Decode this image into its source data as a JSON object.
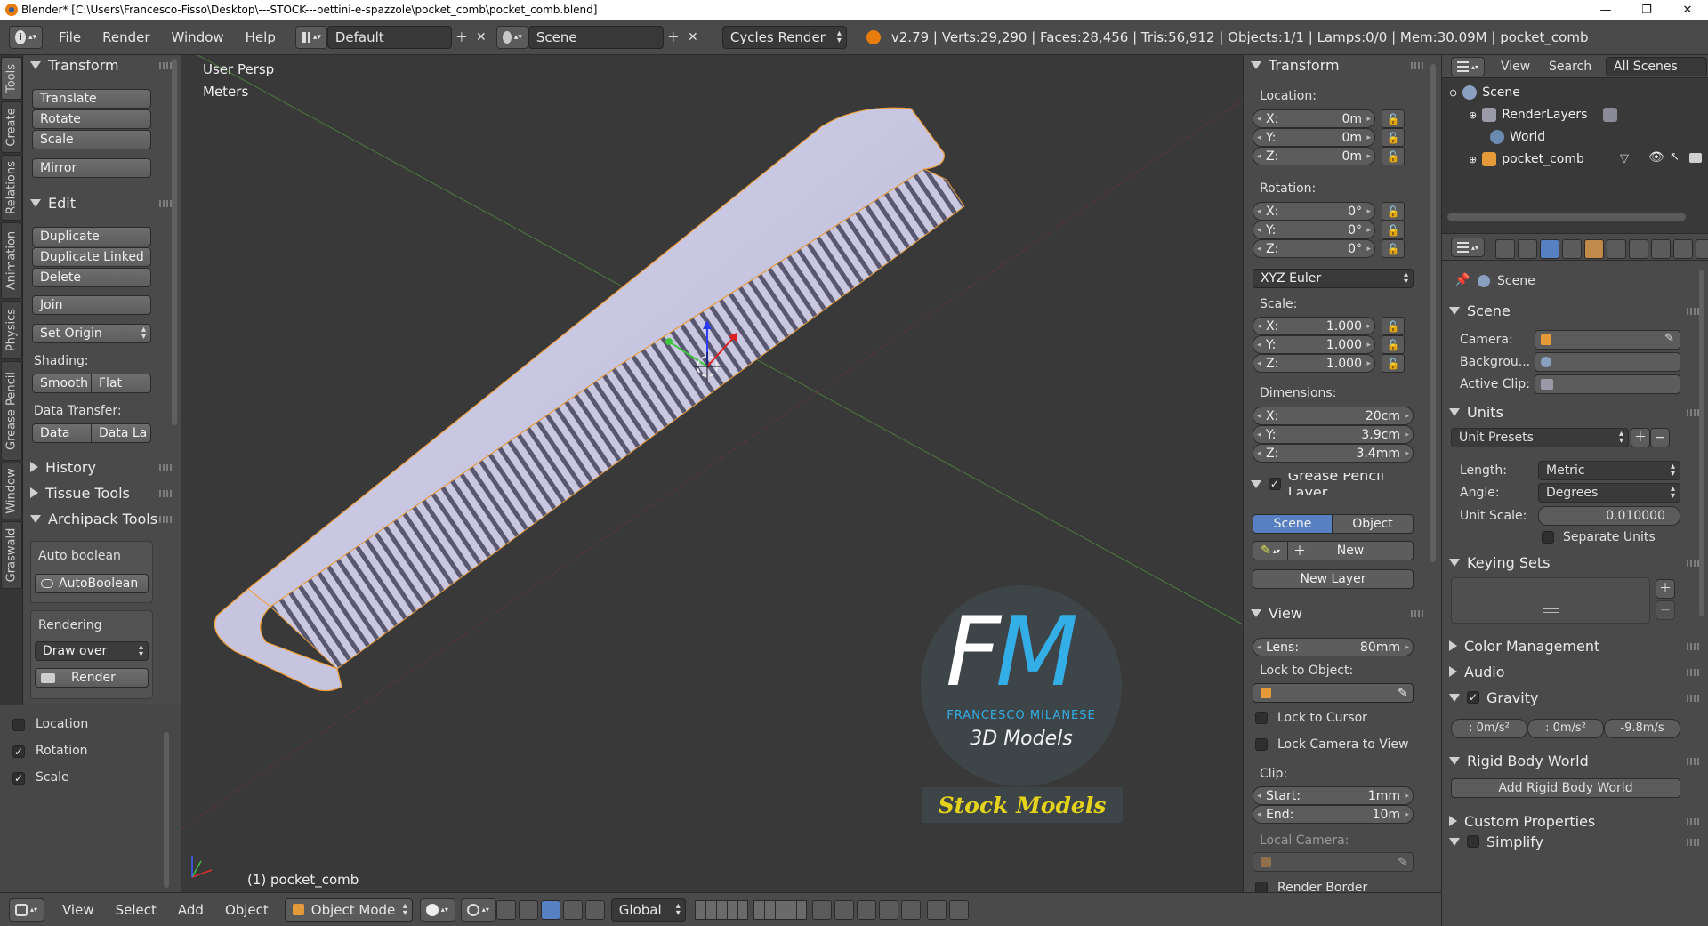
{
  "window": {
    "title": "Blender* [C:\\Users\\Francesco-Fisso\\Desktop\\---STOCK---pettini-e-spazzole\\pocket_comb\\pocket_comb.blend]",
    "minimize": "—",
    "maximize": "❐",
    "close": "✕"
  },
  "infobar": {
    "info_icon": "i",
    "menus": [
      "File",
      "Render",
      "Window",
      "Help"
    ],
    "layout": "Default",
    "scene": "Scene",
    "engine": "Cycles Render",
    "stats": "v2.79 | Verts:29,290 | Faces:28,456 | Tris:56,912 | Objects:1/1 | Lamps:0/0 | Mem:30.09M | pocket_comb"
  },
  "vtabs": [
    "Tools",
    "Create",
    "Relations",
    "Animation",
    "Physics",
    "Grease Pencil",
    "Window",
    "Graswald"
  ],
  "toolshelf": {
    "transform": {
      "title": "Transform",
      "buttons": [
        "Translate",
        "Rotate",
        "Scale",
        "Mirror"
      ]
    },
    "edit": {
      "title": "Edit",
      "buttons": [
        "Duplicate",
        "Duplicate Linked",
        "Delete",
        "Join"
      ],
      "set_origin": "Set Origin",
      "shading_label": "Shading:",
      "smooth": "Smooth",
      "flat": "Flat",
      "data_transfer_label": "Data Transfer:",
      "data": "Data",
      "data_la": "Data La"
    },
    "history": "History",
    "tissue_tools": "Tissue Tools",
    "archipack": {
      "title": "Archipack Tools",
      "auto_boolean_label": "Auto boolean",
      "auto_boolean_btn": "AutoBoolean",
      "rendering_label": "Rendering",
      "draw_over": "Draw over",
      "render": "Render"
    }
  },
  "operator_panel": {
    "items": [
      {
        "label": "Location",
        "checked": false
      },
      {
        "label": "Rotation",
        "checked": true
      },
      {
        "label": "Scale",
        "checked": true
      }
    ]
  },
  "viewport": {
    "view_name": "User Persp",
    "units": "Meters",
    "object_label": "(1) pocket_comb",
    "watermark": {
      "letters_f": "F",
      "letters_m": "M",
      "author": "FRANCESCO MILANESE",
      "subtitle": "3D Models",
      "banner": "Stock Models",
      "accent": "#33aee6",
      "banner_color": "#e5d21a"
    }
  },
  "npanel": {
    "transform_title": "Transform",
    "location_label": "Location:",
    "location": [
      {
        "k": "X:",
        "v": "0m"
      },
      {
        "k": "Y:",
        "v": "0m"
      },
      {
        "k": "Z:",
        "v": "0m"
      }
    ],
    "rotation_label": "Rotation:",
    "rotation": [
      {
        "k": "X:",
        "v": "0°"
      },
      {
        "k": "Y:",
        "v": "0°"
      },
      {
        "k": "Z:",
        "v": "0°"
      }
    ],
    "rotation_mode": "XYZ Euler",
    "scale_label": "Scale:",
    "scale": [
      {
        "k": "X:",
        "v": "1.000"
      },
      {
        "k": "Y:",
        "v": "1.000"
      },
      {
        "k": "Z:",
        "v": "1.000"
      }
    ],
    "dimensions_label": "Dimensions:",
    "dimensions": [
      {
        "k": "X:",
        "v": "20cm"
      },
      {
        "k": "Y:",
        "v": "3.9cm"
      },
      {
        "k": "Z:",
        "v": "3.4mm"
      }
    ],
    "grease_pencil_title": "Grease Pencil Layer",
    "gp_scene": "Scene",
    "gp_object": "Object",
    "gp_new": "New",
    "gp_new_layer": "New Layer",
    "view_title": "View",
    "lens_label": "Lens:",
    "lens_value": "80mm",
    "lock_to_object_label": "Lock to Object:",
    "lock_to_cursor": "Lock to Cursor",
    "lock_camera_to_view": "Lock Camera to View",
    "clip_label": "Clip:",
    "clip_start_label": "Start:",
    "clip_start_value": "1mm",
    "clip_end_label": "End:",
    "clip_end_value": "10m",
    "local_camera_label": "Local Camera:",
    "render_border": "Render Border"
  },
  "outliner": {
    "view": "View",
    "search": "Search",
    "filter": "All Scenes",
    "rows": [
      {
        "label": "Scene"
      },
      {
        "label": "RenderLayers"
      },
      {
        "label": "World"
      },
      {
        "label": "pocket_comb"
      }
    ]
  },
  "properties": {
    "context_scene": "Scene",
    "scene_section": "Scene",
    "camera_label": "Camera:",
    "background_label": "Backgrou...",
    "active_clip_label": "Active Clip:",
    "units_section": "Units",
    "unit_presets": "Unit Presets",
    "length_label": "Length:",
    "length_value": "Metric",
    "angle_label": "Angle:",
    "angle_value": "Degrees",
    "unit_scale_label": "Unit Scale:",
    "unit_scale_value": "0.010000",
    "separate_units": "Separate Units",
    "keying_sets_section": "Keying Sets",
    "color_management_section": "Color Management",
    "audio_section": "Audio",
    "gravity_section": "Gravity",
    "gravity_values": [
      ": 0m/s²",
      ": 0m/s²",
      "-9.8m/s"
    ],
    "rigid_body_section": "Rigid Body World",
    "add_rigid_body": "Add Rigid Body World",
    "custom_props_section": "Custom Properties",
    "simplify_section": "Simplify"
  },
  "bottombar": {
    "menus": [
      "View",
      "Select",
      "Add",
      "Object"
    ],
    "mode": "Object Mode",
    "orientation": "Global"
  }
}
